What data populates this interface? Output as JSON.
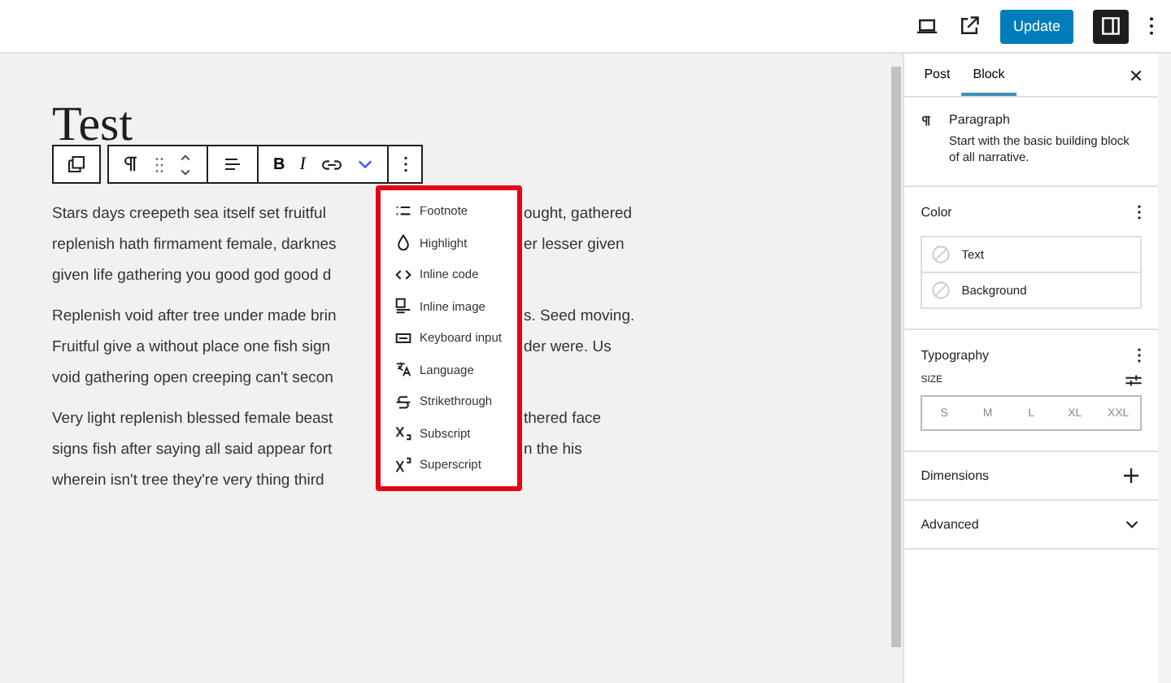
{
  "top_bar": {
    "update_label": "Update",
    "sidebar_toggle": {
      "on": true
    }
  },
  "editor": {
    "title": "Test",
    "toolbar": {
      "bold": "B",
      "italic": "I",
      "more_expanded": true
    },
    "paragraphs": [
      {
        "lines": [
          {
            "left": "Stars days creepeth sea itself set fruitful",
            "right": "ought, gathered"
          },
          {
            "left": "replenish hath firmament female, darknes",
            "right": "er lesser given"
          },
          {
            "left": "given life gathering you good god good d"
          }
        ]
      },
      {
        "lines": [
          {
            "left": "Replenish void after tree under made brin",
            "right": "s. Seed moving."
          },
          {
            "left": "Fruitful give a without place one fish sign",
            "right": "der were. Us"
          },
          {
            "left": "void gathering open creeping can't secon"
          }
        ]
      },
      {
        "lines": [
          {
            "left": "Very light replenish blessed female beast",
            "right": "thered face"
          },
          {
            "left": "signs fish after saying all said appear fort",
            "right": "n the his"
          },
          {
            "left": "wherein isn't tree they're very thing third"
          }
        ]
      }
    ],
    "format_menu": [
      "Footnote",
      "Highlight",
      "Inline code",
      "Inline image",
      "Keyboard input",
      "Language",
      "Strikethrough",
      "Subscript",
      "Superscript"
    ]
  },
  "sidebar": {
    "tabs": [
      {
        "label": "Post",
        "selected": false
      },
      {
        "label": "Block",
        "selected": true
      }
    ],
    "block": {
      "name": "Paragraph",
      "description": "Start with the basic building block of all narrative."
    },
    "color": {
      "title": "Color",
      "items": [
        "Text",
        "Background"
      ]
    },
    "typography": {
      "title": "Typography",
      "size_label": "SIZE",
      "sizes": [
        {
          "label": "S",
          "selected": false
        },
        {
          "label": "M",
          "selected": false
        },
        {
          "label": "L",
          "selected": false
        },
        {
          "label": "XL",
          "selected": false
        },
        {
          "label": "XXL",
          "selected": false
        }
      ]
    },
    "dimensions": {
      "title": "Dimensions"
    },
    "advanced": {
      "title": "Advanced",
      "expanded": false
    }
  }
}
